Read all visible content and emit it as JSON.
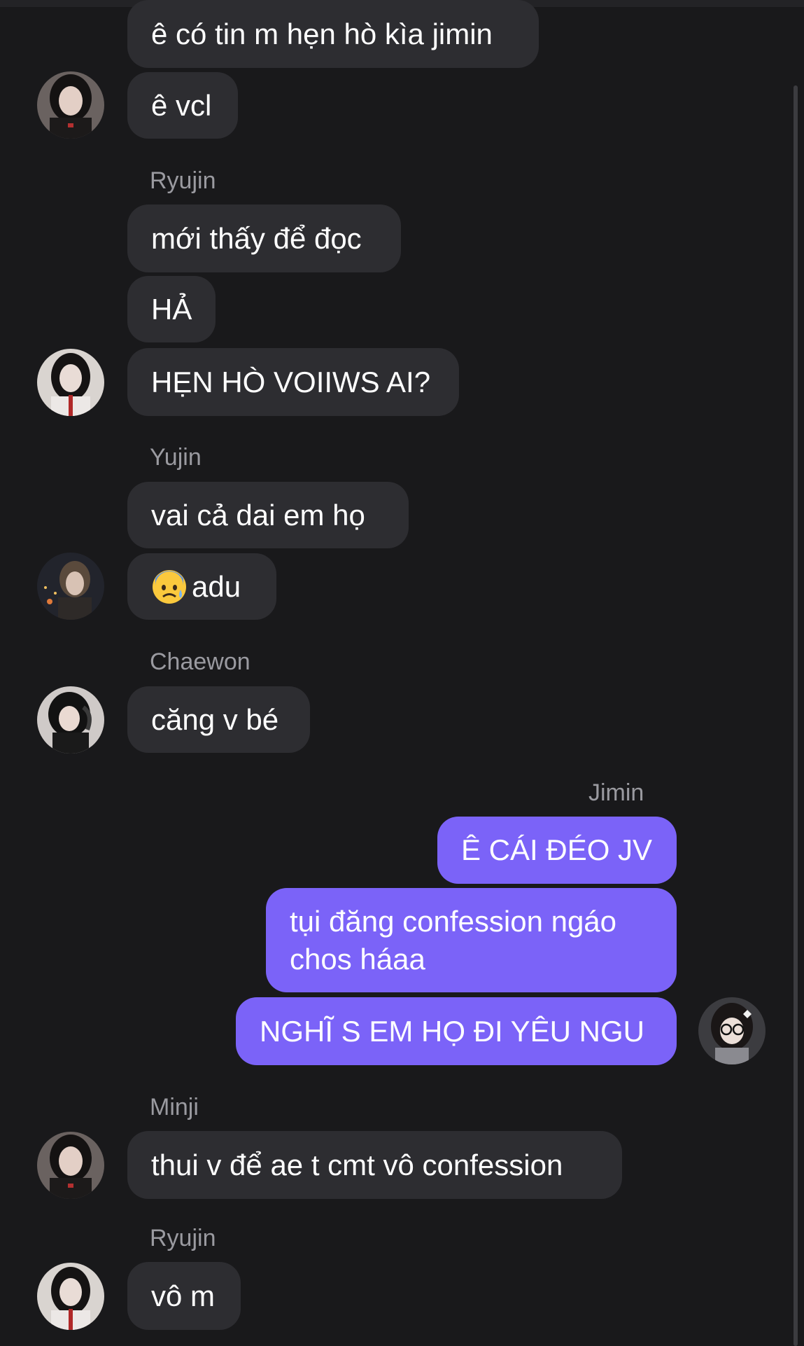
{
  "chat": {
    "m1": "ê có tin m hẹn hò kìa jimin",
    "m2": "ê vcl",
    "sender_ryujin": "Ryujin",
    "m3": "mới thấy để đọc",
    "m4": "HẢ",
    "m5": "HẸN HÒ VOIIWS AI?",
    "sender_yujin": "Yujin",
    "m6": "vai cả dai em họ",
    "m7_emoji": "😰",
    "m7": "adu",
    "sender_chaewon": "Chaewon",
    "m8": "căng v bé",
    "sender_jimin": "Jimin",
    "m9": "Ê CÁI ĐÉO JV",
    "m10": "tụi đăng confession ngáo chos háaa",
    "m11": "NGHĨ S EM HỌ ĐI YÊU NGU",
    "sender_minji": "Minji",
    "m12": "thui v để ae t cmt vô confession",
    "sender_ryujin_2": "Ryujin",
    "m13": "vô m"
  },
  "colors": {
    "background": "#19191b",
    "incoming_bubble": "#2d2d31",
    "outgoing_bubble": "#7b63f8",
    "sender_name": "#9a9aa0"
  }
}
